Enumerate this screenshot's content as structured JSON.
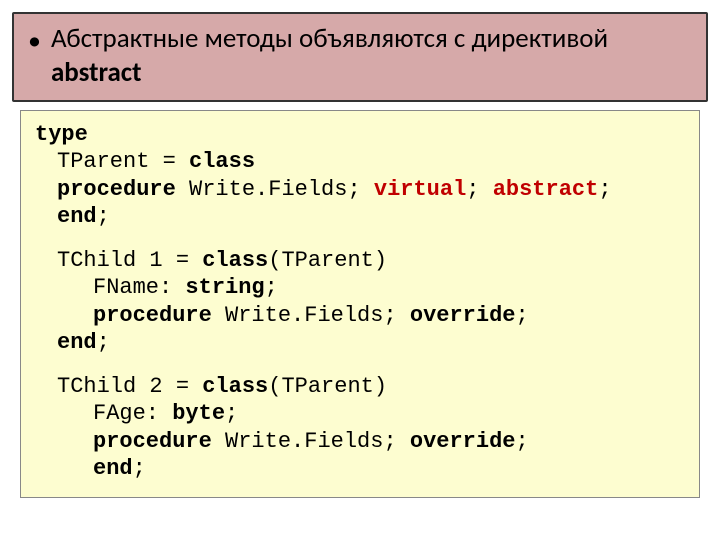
{
  "heading": {
    "bullet": "•",
    "text_plain": "Абстрактные методы объявляются с директивой ",
    "text_bold": "abstract"
  },
  "code": {
    "block1": {
      "l1_kw": "type",
      "l2_pre": "TParent = ",
      "l2_kw": "class",
      "l3_pre": " ",
      "l3_kw1": "procedure",
      "l3_mid": " Write.Fields; ",
      "l3_kwred1": "virtual",
      "l3_sep": "; ",
      "l3_kwred2": "abstract",
      "l3_end": ";",
      "l4_kw": "end",
      "l4_end": ";"
    },
    "block2": {
      "l1_pre": "TChild 1 = ",
      "l1_kw": "class",
      "l1_post": "(TParent)",
      "l2_pre": "FName: ",
      "l2_kw": "string",
      "l2_end": ";",
      "l3_kw1": "procedure",
      "l3_mid": " Write.Fields; ",
      "l3_kw2": "override",
      "l3_end": ";",
      "l4_kw": "end",
      "l4_end": ";"
    },
    "block3": {
      "l1_pre": "TChild 2 = ",
      "l1_kw": "class",
      "l1_post": "(TParent)",
      "l2_pre": "FAge: ",
      "l2_kw": "byte",
      "l2_end": ";",
      "l3_kw1": "procedure",
      "l3_mid": " Write.Fields; ",
      "l3_kw2": "override",
      "l3_end": ";",
      "l4_kw": "end",
      "l4_end": ";"
    }
  }
}
